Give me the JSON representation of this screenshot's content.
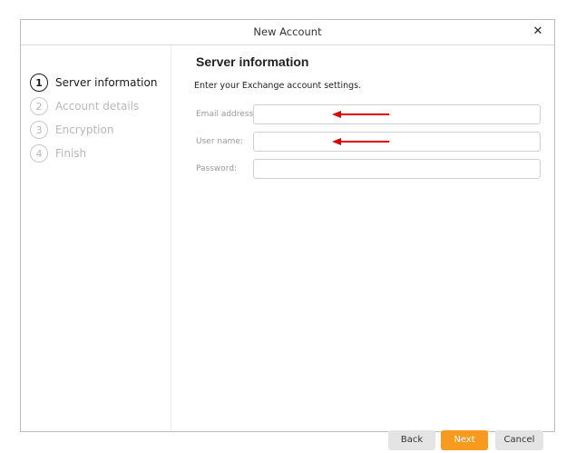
{
  "window": {
    "title": "New Account",
    "close_glyph": "✕"
  },
  "steps": [
    {
      "number": "1",
      "label": "Server information",
      "state": "active"
    },
    {
      "number": "2",
      "label": "Account details",
      "state": "inactive"
    },
    {
      "number": "3",
      "label": "Encryption",
      "state": "inactive"
    },
    {
      "number": "4",
      "label": "Finish",
      "state": "inactive"
    }
  ],
  "main": {
    "heading": "Server information",
    "subtitle": "Enter your Exchange account settings.",
    "fields": [
      {
        "label": "Email address:",
        "value": "",
        "placeholder": ""
      },
      {
        "label": "User name:",
        "value": "",
        "placeholder": ""
      },
      {
        "label": "Password:",
        "value": "",
        "placeholder": ""
      }
    ]
  },
  "annotations": {
    "arrow_color": "#e00000"
  },
  "buttons": {
    "back": "Back",
    "next": "Next",
    "cancel": "Cancel"
  },
  "colors": {
    "accent": "#f79a1d",
    "secondary_button": "#e4e4e4"
  }
}
